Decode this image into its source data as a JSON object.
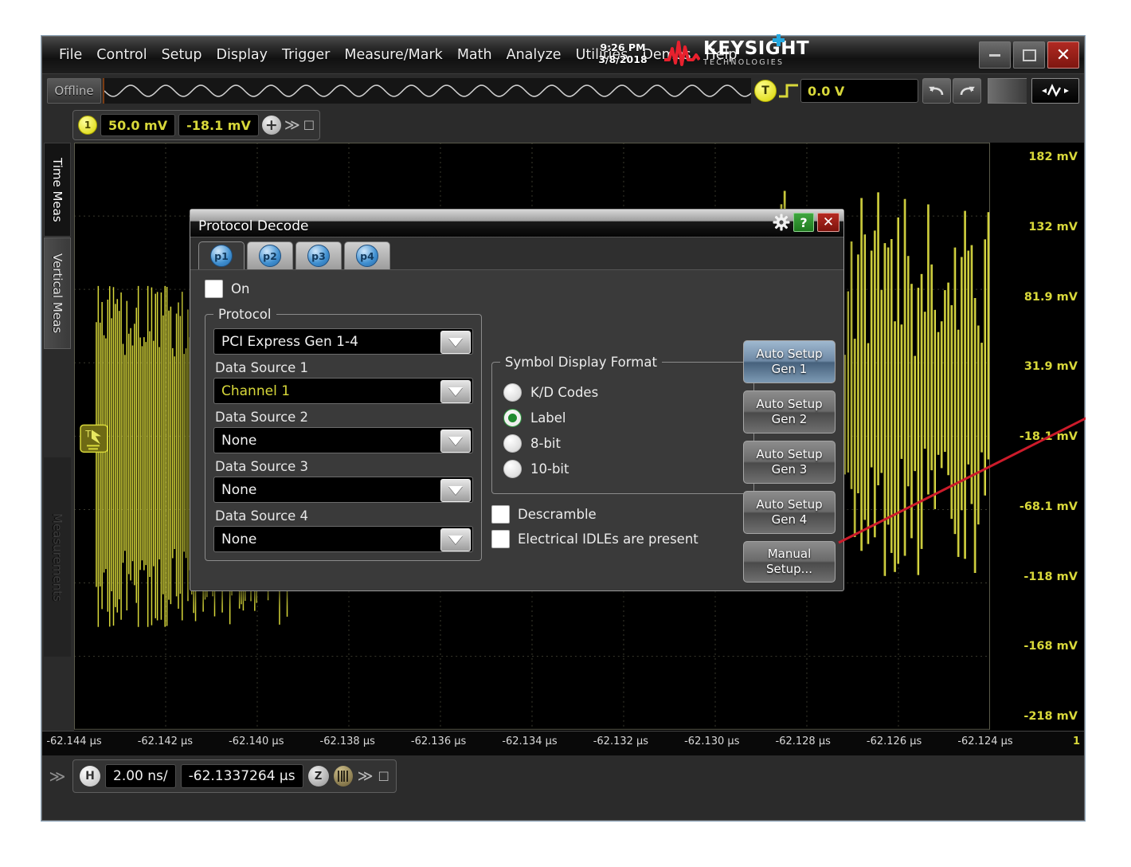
{
  "window": {
    "menu": [
      "File",
      "Control",
      "Setup",
      "Display",
      "Trigger",
      "Measure/Mark",
      "Math",
      "Analyze",
      "Utilities",
      "Demos",
      "Help"
    ],
    "clock_time": "9:26 PM",
    "clock_date": "3/8/2018",
    "brand_main": "KEYSIGHT",
    "brand_sub": "TECHNOLOGIES",
    "minimize_label": "_",
    "maximize_label": "□",
    "close_label": "✕"
  },
  "toolbar": {
    "offline_label": "Offline",
    "trigger_badge": "T",
    "trigger_level": "0.0 V",
    "undo_label": "↶",
    "redo_label": "↷"
  },
  "channel": {
    "number": "1",
    "scale": "50.0 mV",
    "offset": "-18.1 mV",
    "add_label": "+",
    "more_label": "≫",
    "pin_label": "☐"
  },
  "sidebar": {
    "tabs": [
      "Time Meas",
      "Vertical Meas"
    ],
    "watermark": "Measurements"
  },
  "plot": {
    "y_labels": [
      "182 mV",
      "132 mV",
      "81.9 mV",
      "31.9 mV",
      "-18.1 mV",
      "-68.1 mV",
      "-118 mV",
      "-168 mV",
      "-218 mV"
    ],
    "x_labels": [
      "-62.144 µs",
      "-62.142 µs",
      "-62.140 µs",
      "-62.138 µs",
      "-62.136 µs",
      "-62.134 µs",
      "-62.132 µs",
      "-62.130 µs",
      "-62.128 µs",
      "-62.126 µs",
      "-62.124 µs"
    ],
    "x_end_marker": "1",
    "trace_color": "#d8d83a",
    "annotation_color": "#cc1b2a"
  },
  "status": {
    "h_badge": "H",
    "timebase": "2.00 ns/",
    "delay": "-62.1337264 µs",
    "zoom_label": "Z",
    "more_label": "≫",
    "pin_label": "☐",
    "expand_label": "≫"
  },
  "dialog": {
    "title": "Protocol Decode",
    "help_label": "?",
    "close_label": "✕",
    "tabs": [
      {
        "label": "p1",
        "active": true
      },
      {
        "label": "p2",
        "active": false
      },
      {
        "label": "p3",
        "active": false
      },
      {
        "label": "p4",
        "active": false
      }
    ],
    "on_label": "On",
    "on_checked": false,
    "protocol_group_label": "Protocol",
    "protocol_value": "PCI Express Gen 1-4",
    "sources": [
      {
        "label": "Data Source 1",
        "value": "Channel 1",
        "highlight": true
      },
      {
        "label": "Data Source 2",
        "value": "None",
        "highlight": false
      },
      {
        "label": "Data Source 3",
        "value": "None",
        "highlight": false
      },
      {
        "label": "Data Source 4",
        "value": "None",
        "highlight": false
      }
    ],
    "symbol_group_label": "Symbol Display Format",
    "symbol_options": [
      {
        "label": "K/D Codes",
        "selected": false
      },
      {
        "label": "Label",
        "selected": true
      },
      {
        "label": "8-bit",
        "selected": false
      },
      {
        "label": "10-bit",
        "selected": false
      }
    ],
    "descramble_label": "Descramble",
    "descramble_checked": false,
    "idle_label": "Electrical IDLEs are present",
    "idle_checked": false,
    "action_buttons": [
      {
        "line1": "Auto Setup",
        "line2": "Gen 1",
        "highlight": true
      },
      {
        "line1": "Auto Setup",
        "line2": "Gen 2",
        "highlight": false
      },
      {
        "line1": "Auto Setup",
        "line2": "Gen 3",
        "highlight": false
      },
      {
        "line1": "Auto Setup",
        "line2": "Gen 4",
        "highlight": false
      }
    ],
    "manual_line1": "Manual",
    "manual_line2": "Setup..."
  }
}
